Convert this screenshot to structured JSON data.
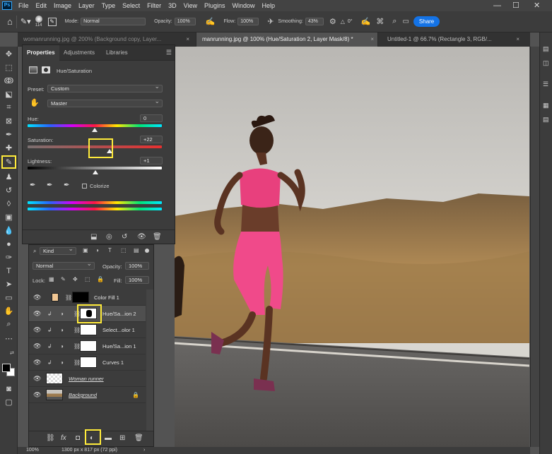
{
  "menubar": {
    "logo": "Ps",
    "items": [
      "File",
      "Edit",
      "Image",
      "Layer",
      "Type",
      "Select",
      "Filter",
      "3D",
      "View",
      "Plugins",
      "Window",
      "Help"
    ],
    "min": "—",
    "max": "☐",
    "close": "✕"
  },
  "options": {
    "brush_size": "114",
    "mode_label": "Mode:",
    "mode_value": "Normal",
    "opacity_label": "Opacity:",
    "opacity_value": "100%",
    "flow_label": "Flow:",
    "flow_value": "100%",
    "smoothing_label": "Smoothing:",
    "smoothing_value": "43%",
    "angle_value": "0°",
    "share_label": "Share"
  },
  "tabs": [
    {
      "label": "womanrunning.jpg @ 200% (Background copy, Layer..."
    },
    {
      "label": "manrunning.jpg @ 100% (Hue/Saturation 2, Layer Mask/8) *"
    },
    {
      "label": "Untitled-1 @ 66.7% (Rectangle 3, RGB/..."
    }
  ],
  "properties": {
    "tabs": [
      "Properties",
      "Adjustments",
      "Libraries"
    ],
    "title": "Hue/Saturation",
    "preset_label": "Preset:",
    "preset_value": "Custom",
    "channel_value": "Master",
    "hue_label": "Hue:",
    "hue_value": "0",
    "saturation_label": "Saturation:",
    "saturation_value": "+22",
    "lightness_label": "Lightness:",
    "lightness_value": "+1",
    "colorize_label": "Colorize",
    "hue_level": 0,
    "saturation_level": 22,
    "lightness_level": 1
  },
  "layers": {
    "filter_value": "Kind",
    "blend_value": "Normal",
    "opacity_label": "Opacity:",
    "opacity_value": "100%",
    "lock_label": "Lock:",
    "fill_label": "Fill:",
    "fill_value": "100%",
    "rows": [
      {
        "name": "Color Fill 1"
      },
      {
        "name": "Hue/Sa...ion 2"
      },
      {
        "name": "Select...olor 1"
      },
      {
        "name": "Hue/Sa...ion 1"
      },
      {
        "name": "Curves 1"
      },
      {
        "name": "Woman runner"
      },
      {
        "name": "Background"
      }
    ]
  },
  "status": {
    "zoom": "100%",
    "doc_size": "1300 px x 817 px (72 ppi)"
  },
  "colors": {
    "highlight": "#ffeb3b",
    "accent": "#1473e6",
    "panel": "#3c3c3c",
    "fill_swatch": "#f2c794"
  },
  "icons": [
    "home-icon",
    "brush-icon",
    "airbrush-icon",
    "angle-icon",
    "pressure-icon",
    "symmetry-icon",
    "butterfly-icon",
    "eye-icon",
    "trash-icon",
    "fx-icon",
    "mask-icon",
    "folder-icon",
    "adjustment-icon"
  ]
}
